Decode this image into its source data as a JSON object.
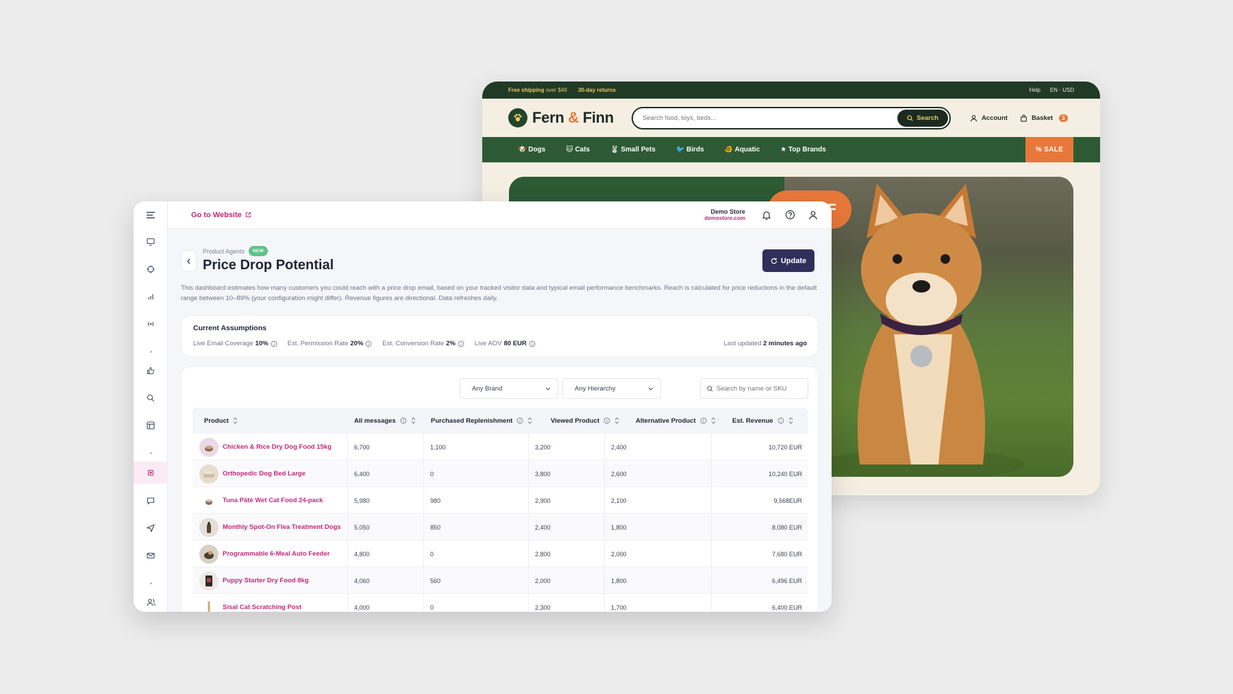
{
  "store": {
    "topbar": {
      "free_shipping_bold": "Free shipping",
      "free_shipping_rest": "over $49",
      "returns": "30-day returns",
      "help": "Help",
      "locale": "EN · USD"
    },
    "logo": {
      "part1": "Fern",
      "amp": "&",
      "part2": "Finn"
    },
    "search": {
      "placeholder": "Search food, toys, beds...",
      "button": "Search"
    },
    "account": "Account",
    "basket": {
      "label": "Basket",
      "count": "3"
    },
    "nav": [
      "🐶 Dogs",
      "🐱 Cats",
      "🐰 Small Pets",
      "🐦 Birds",
      "🐠 Aquatic",
      "★ Top Brands"
    ],
    "sale": "% SALE",
    "hero_badge": "F"
  },
  "dashboard": {
    "goto": "Go to Website",
    "store_name": "Demo Store",
    "store_url": "demostore.com",
    "breadcrumb": "Product Agents",
    "new_badge": "NEW",
    "title": "Price Drop Potential",
    "update_button": "Update",
    "description": "This dashboard estimates how many customers you could reach with a price drop email, based on your tracked visitor data and typical email performance benchmarks. Reach is calculated for price reductions in the default range between 10–89% (your configuration might differ). Revenue figures are directional. Data refreshes daily.",
    "assumptions": {
      "heading": "Current Assumptions",
      "items": [
        {
          "label": "Live Email Coverage",
          "value": "10%"
        },
        {
          "label": "Est. Permission Rate",
          "value": "20%"
        },
        {
          "label": "Est. Conversion Rate",
          "value": "2%"
        },
        {
          "label": "Live AOV",
          "value": "80 EUR"
        }
      ],
      "last_updated_label": "Last updated",
      "last_updated_value": "2 minutes ago"
    },
    "filters": {
      "brand": "Any Brand",
      "hierarchy": "Any Hierarchy",
      "search_placeholder": "Search by name or SKU"
    },
    "columns": [
      "Product",
      "All messages",
      "Purchased Replenishment",
      "Viewed Product",
      "Alternative Product",
      "Est. Revenue"
    ],
    "rows": [
      {
        "product": "Chicken & Rice Dry Dog Food 15kg",
        "all": "6,700",
        "repl": "1,100",
        "viewed": "3,200",
        "alt": "2,400",
        "rev": "10,720 EUR"
      },
      {
        "product": "Orthopedic Dog Bed Large",
        "all": "6,400",
        "repl": "0",
        "viewed": "3,800",
        "alt": "2,600",
        "rev": "10,240 EUR"
      },
      {
        "product": "Tuna Pâté Wet Cat Food 24-pack",
        "all": "5,980",
        "repl": "980",
        "viewed": "2,900",
        "alt": "2,100",
        "rev": "9,568EUR"
      },
      {
        "product": "Monthly Spot-On Flea Treatment Dogs",
        "all": "5,050",
        "repl": "850",
        "viewed": "2,400",
        "alt": "1,800",
        "rev": "8,080 EUR"
      },
      {
        "product": "Programmable 6-Meal Auto Feeder",
        "all": "4,800",
        "repl": "0",
        "viewed": "2,800",
        "alt": "2,000",
        "rev": "7,680 EUR"
      },
      {
        "product": "Puppy Starter Dry Food 8kg",
        "all": "4,060",
        "repl": "560",
        "viewed": "2,000",
        "alt": "1,800",
        "rev": "6,496 EUR"
      },
      {
        "product": "Sisal Cat Scratching Post",
        "all": "4,000",
        "repl": "0",
        "viewed": "2,300",
        "alt": "1,700",
        "rev": "6,400 EUR"
      }
    ]
  },
  "colors": {
    "accent": "#c3287a",
    "store_green": "#2d5a34",
    "store_orange": "#e8783a",
    "update_button": "#302f5b"
  }
}
